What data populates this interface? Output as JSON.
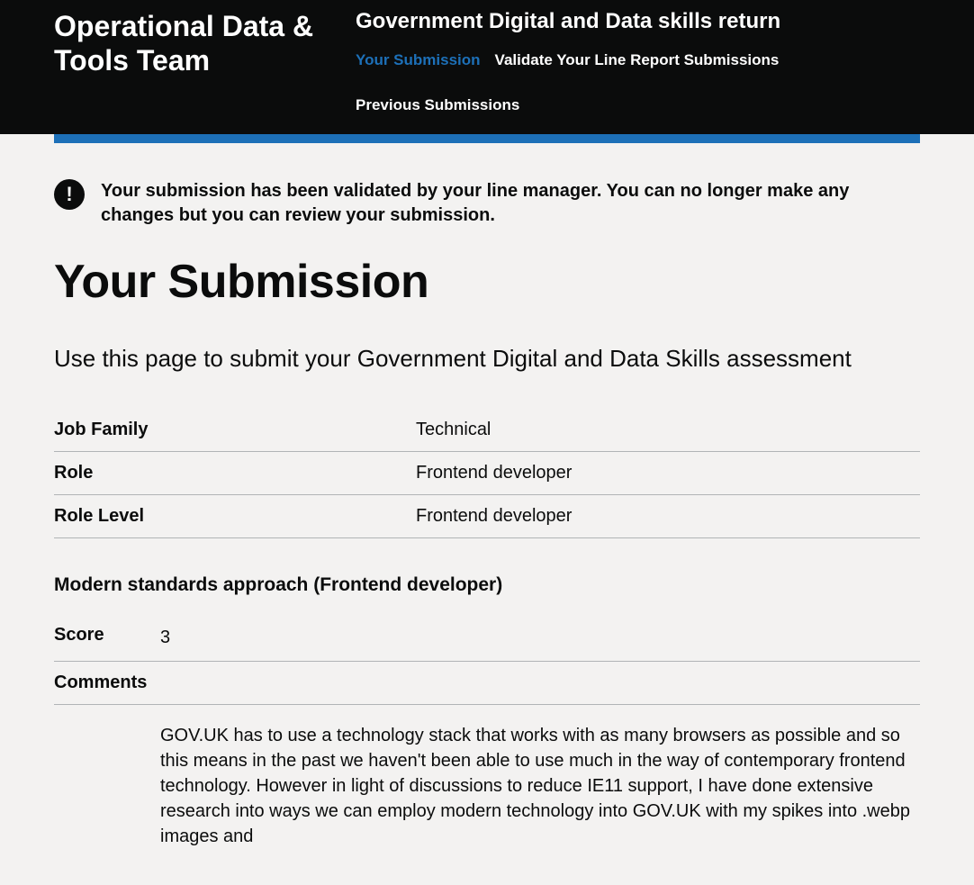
{
  "header": {
    "team_name": "Operational Data & Tools Team",
    "service_name": "Government Digital and Data skills return",
    "nav": [
      {
        "label": "Your Submission",
        "active": true
      },
      {
        "label": "Validate Your Line Report Submissions",
        "active": false
      },
      {
        "label": "Previous Submissions",
        "active": false
      }
    ]
  },
  "notification": {
    "text": "Your submission has been validated by your line manager. You can no longer make any changes but you can review your submission."
  },
  "page": {
    "title": "Your Submission",
    "description": "Use this page to submit your Government Digital and Data Skills assessment"
  },
  "summary": [
    {
      "key": "Job Family",
      "value": "Technical"
    },
    {
      "key": "Role",
      "value": "Frontend developer"
    },
    {
      "key": "Role Level",
      "value": "Frontend developer"
    }
  ],
  "section": {
    "heading": "Modern standards approach (Frontend developer)",
    "score_label": "Score",
    "score_value": "3",
    "comments_label": "Comments",
    "comments_body": "GOV.UK has to use a technology stack that works with as many browsers as possible and so this means in the past we haven't been able to use much in the way of contemporary frontend technology. However in light of discussions to reduce IE11 support, I have done extensive research into ways we can employ modern technology into GOV.UK with my spikes into .webp images and"
  }
}
